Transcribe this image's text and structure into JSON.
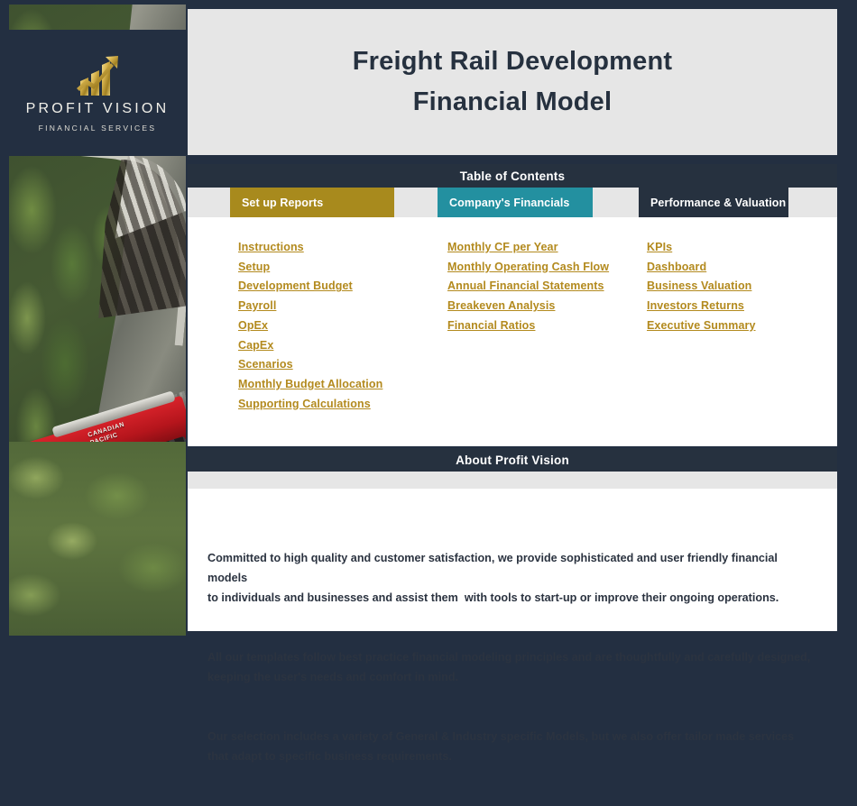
{
  "brand": {
    "logo_icon": "growth-bar-chart-arrow-icon",
    "name": "PROFIT VISION",
    "tagline": "FINANCIAL SERVICES",
    "photo_alt": "canadian-pacific-freight-train-in-forest"
  },
  "title": {
    "line1": "Freight Rail Development",
    "line2": "Financial Model"
  },
  "toc": {
    "header": "Table of Contents",
    "tabs": [
      {
        "label": "Set up Reports",
        "color": "#a88a1d"
      },
      {
        "label": "Company's Financials",
        "color": "#2390a0"
      },
      {
        "label": "Performance & Valuation",
        "color": "#26313f"
      }
    ],
    "columns": [
      {
        "links": [
          "Instructions",
          "Setup",
          "Development Budget",
          "Payroll",
          "OpEx",
          "CapEx",
          "Scenarios",
          "Monthly Budget Allocation",
          "Supporting Calculations"
        ]
      },
      {
        "links": [
          "Monthly CF per Year",
          "Monthly Operating Cash Flow",
          "Annual Financial Statements",
          "Breakeven Analysis",
          "Financial Ratios"
        ]
      },
      {
        "links": [
          "KPIs",
          "Dashboard",
          "Business Valuation",
          "Investors Returns",
          "Executive Summary"
        ]
      }
    ]
  },
  "about": {
    "header": "About Profit Vision",
    "paragraph1": "Committed to high quality and customer satisfaction, we provide sophisticated and user friendly financial models\nto individuals and businesses and assist them  with tools to start-up or improve their ongoing operations.",
    "paragraph2": "All our templates follow best practice financial modeling principles and are thoughtfully and carefully designed,\nkeeping the user's needs and comfort in mind.",
    "paragraph3": "Our selection includes a variety of General & Industry specific Models, but we also offer tailor made services\nthat adapt to specific business requirements."
  },
  "colors": {
    "navy": "#26313f",
    "gold": "#a88a1d",
    "teal": "#2390a0",
    "link_gold": "#b38a1e",
    "light_gray": "#e6e6e6"
  }
}
